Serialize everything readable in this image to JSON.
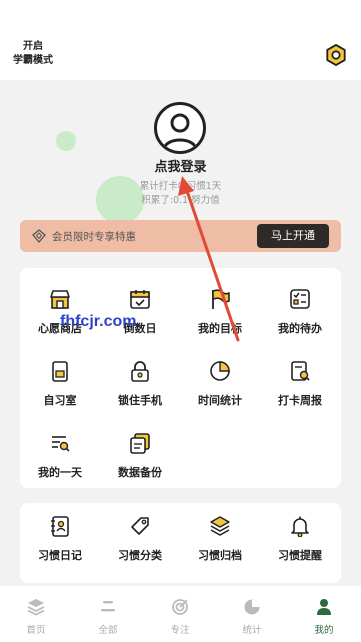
{
  "header": {
    "study_mode_line1": "开启",
    "study_mode_line2": "学霸模式",
    "settings_icon": "gear-icon"
  },
  "profile": {
    "login_text": "点我登录",
    "stats_line1": "累计打卡0 习惯1天",
    "stats_line2": "积累了:0.1 努力值"
  },
  "vip": {
    "text": "会员限时专享特惠",
    "button": "马上开通",
    "color": "#efbda6"
  },
  "tools": [
    {
      "label": "心愿商店",
      "icon": "store-icon"
    },
    {
      "label": "倒数日",
      "icon": "calendar-icon"
    },
    {
      "label": "我的目标",
      "icon": "flag-icon"
    },
    {
      "label": "我的待办",
      "icon": "todo-list-icon"
    },
    {
      "label": "自习室",
      "icon": "study-room-icon"
    },
    {
      "label": "锁住手机",
      "icon": "lock-icon"
    },
    {
      "label": "时间统计",
      "icon": "pie-chart-icon"
    },
    {
      "label": "打卡周报",
      "icon": "weekly-report-icon"
    },
    {
      "label": "我的一天",
      "icon": "day-search-icon"
    },
    {
      "label": "数据备份",
      "icon": "backup-icon"
    }
  ],
  "habits": [
    {
      "label": "习惯日记",
      "icon": "diary-icon"
    },
    {
      "label": "习惯分类",
      "icon": "tag-icon"
    },
    {
      "label": "习惯归档",
      "icon": "archive-layers-icon"
    },
    {
      "label": "习惯提醒",
      "icon": "bell-icon"
    }
  ],
  "watermark": "fhfcjr.com",
  "tabs": [
    {
      "label": "首页",
      "icon": "home-layers-icon"
    },
    {
      "label": "全部",
      "icon": "all-icon"
    },
    {
      "label": "专注",
      "icon": "focus-icon"
    },
    {
      "label": "统计",
      "icon": "stats-icon"
    },
    {
      "label": "我的",
      "icon": "user-icon",
      "active": true
    }
  ],
  "colors": {
    "accent": "#2d6a3e",
    "dark_button": "#2e2a27",
    "icon_yellow": "#f5c542",
    "arrow_red": "#e04a36"
  }
}
